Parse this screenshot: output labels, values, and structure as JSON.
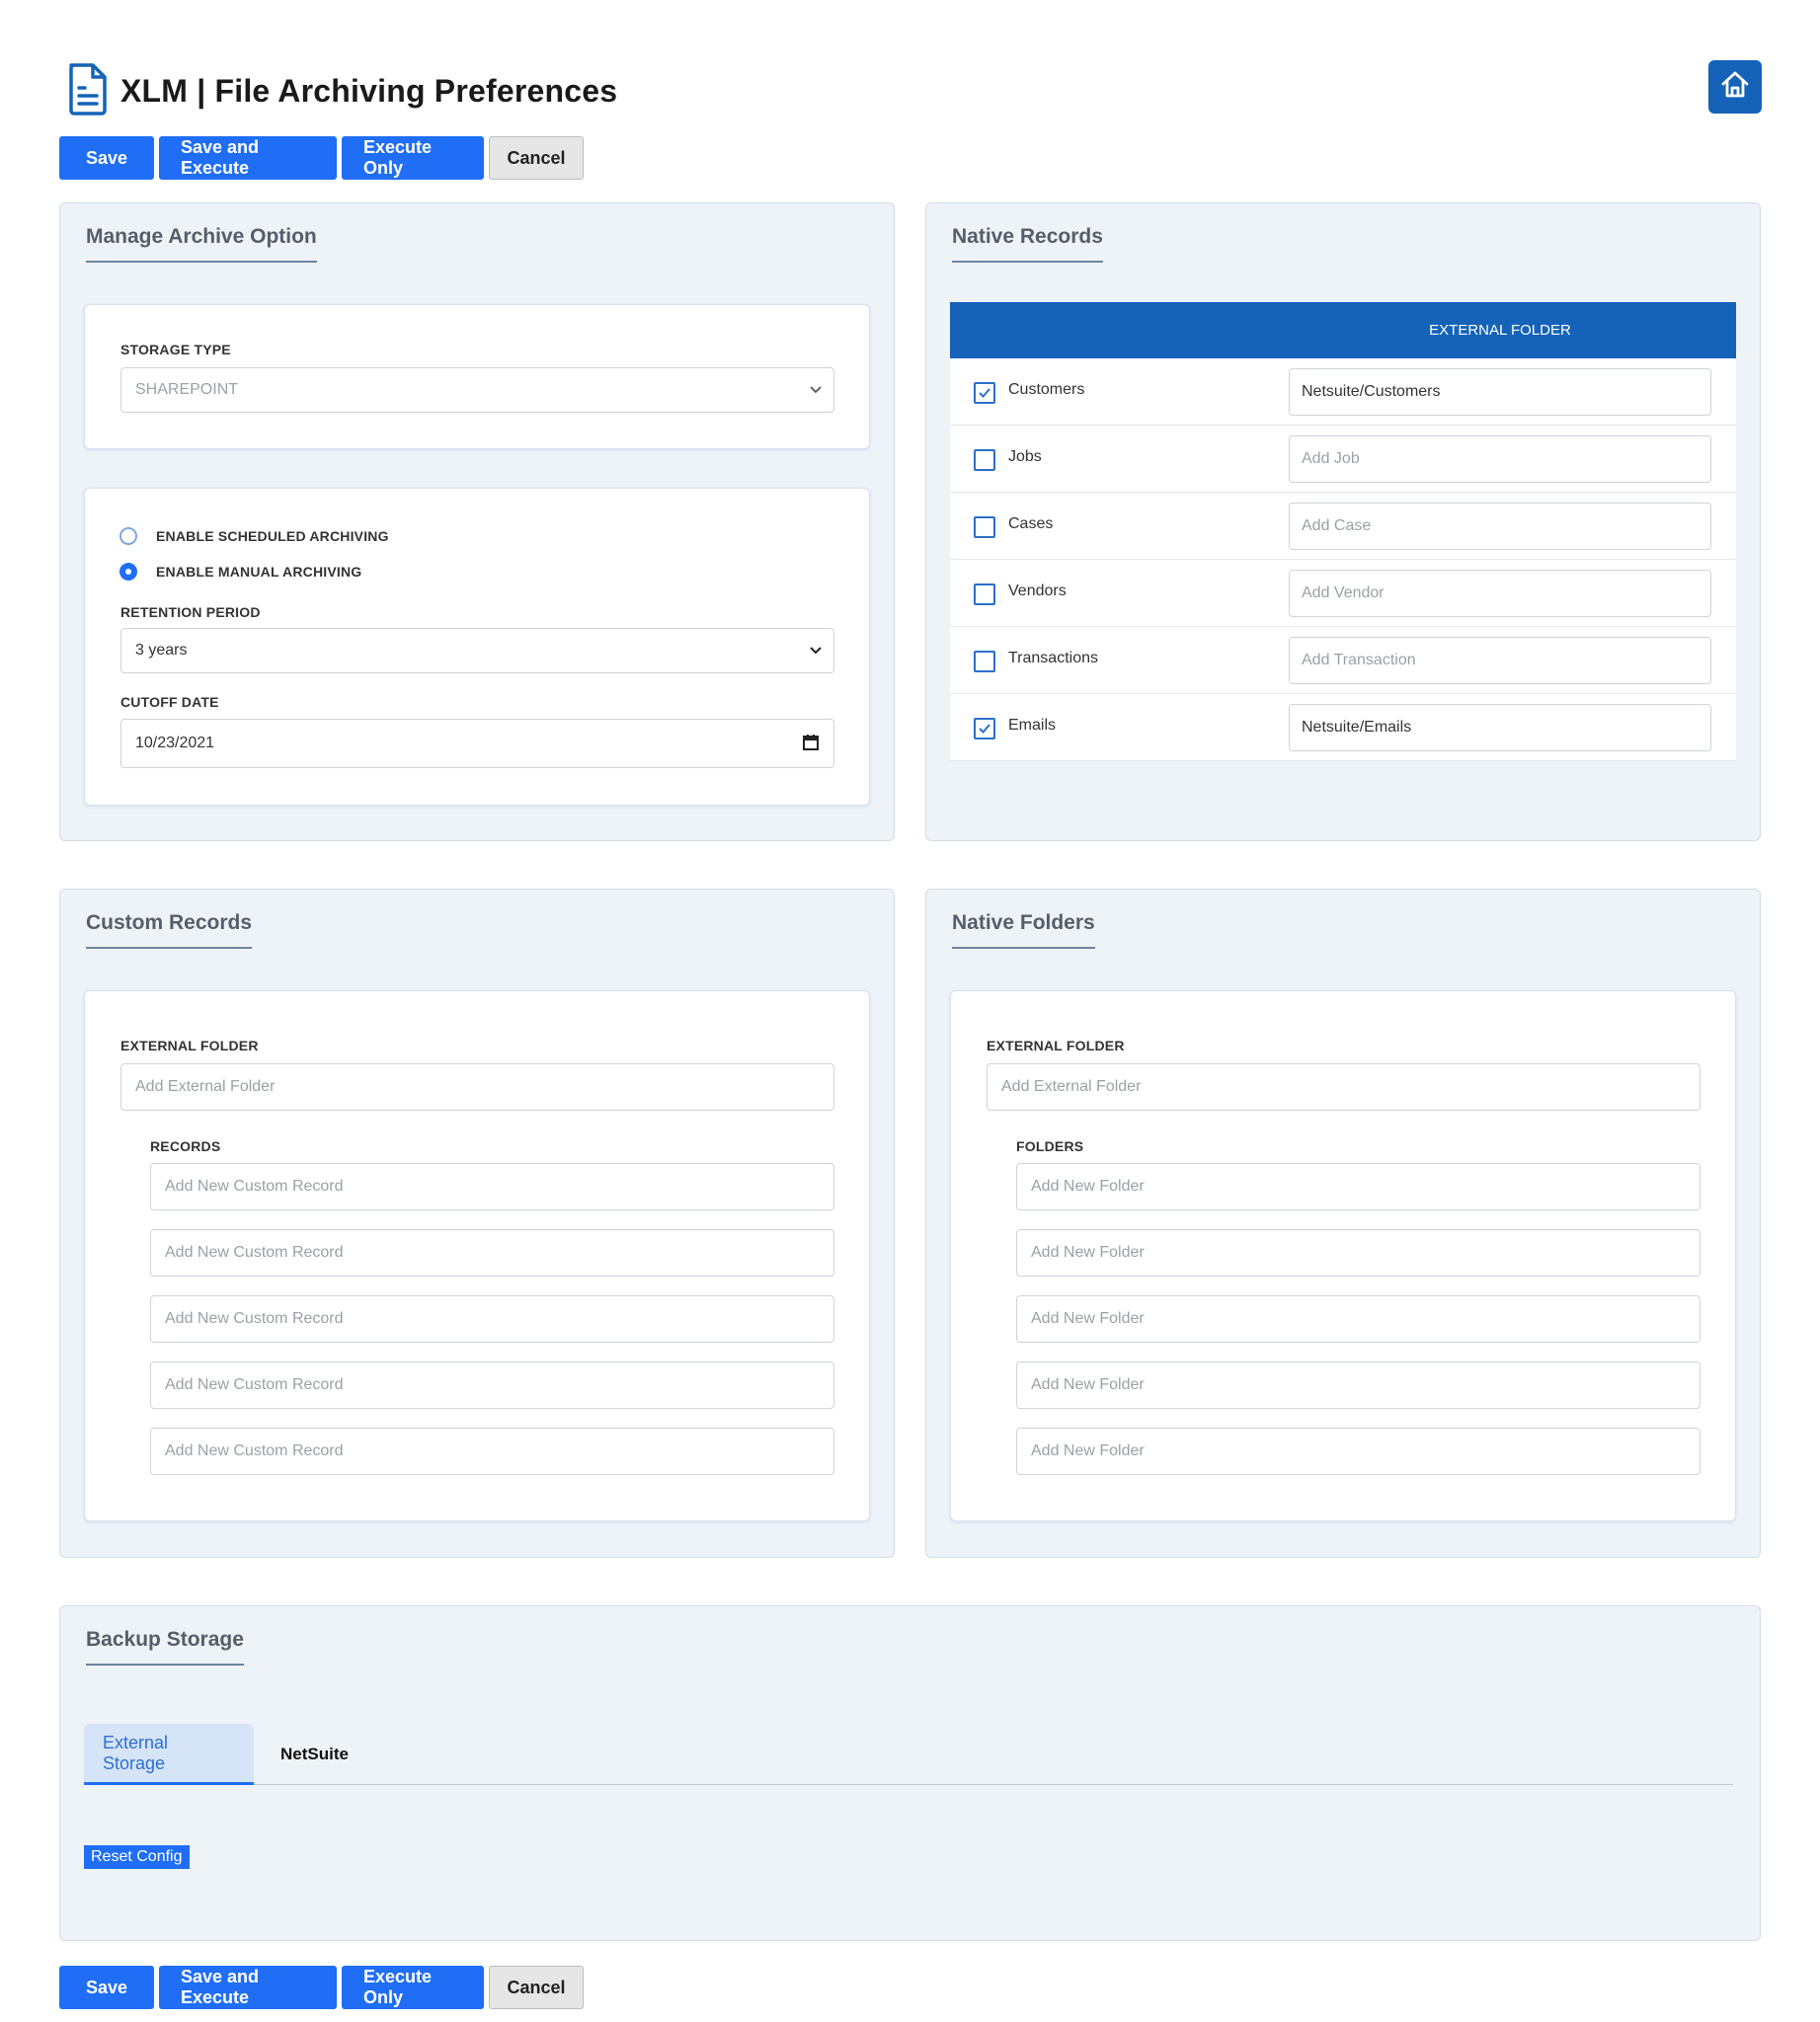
{
  "header": {
    "title": "XLM | File Archiving Preferences",
    "icon": "document-icon",
    "home_icon": "home-icon"
  },
  "actions": {
    "save": "Save",
    "save_execute": "Save and Execute",
    "execute_only": "Execute Only",
    "cancel": "Cancel"
  },
  "manage_archive": {
    "title": "Manage Archive Option",
    "storage_type_label": "STORAGE TYPE",
    "storage_type_value": "SHAREPOINT",
    "radio_scheduled": "ENABLE SCHEDULED ARCHIVING",
    "radio_manual": "ENABLE MANUAL ARCHIVING",
    "selected_mode": "manual",
    "retention_label": "RETENTION PERIOD",
    "retention_value": "3 years",
    "cutoff_label": "CUTOFF DATE",
    "cutoff_value": "10/23/2021"
  },
  "native_records": {
    "title": "Native Records",
    "column_header": "EXTERNAL FOLDER",
    "rows": [
      {
        "label": "Customers",
        "checked": true,
        "value": "Netsuite/Customers",
        "placeholder": ""
      },
      {
        "label": "Jobs",
        "checked": false,
        "value": "",
        "placeholder": "Add Job"
      },
      {
        "label": "Cases",
        "checked": false,
        "value": "",
        "placeholder": "Add Case"
      },
      {
        "label": "Vendors",
        "checked": false,
        "value": "",
        "placeholder": "Add Vendor"
      },
      {
        "label": "Transactions",
        "checked": false,
        "value": "",
        "placeholder": "Add Transaction"
      },
      {
        "label": "Emails",
        "checked": true,
        "value": "Netsuite/Emails",
        "placeholder": ""
      }
    ]
  },
  "custom_records": {
    "title": "Custom Records",
    "external_folder_label": "EXTERNAL FOLDER",
    "external_folder_placeholder": "Add External Folder",
    "records_label": "RECORDS",
    "records": [
      "Add New Custom Record",
      "Add New Custom Record",
      "Add New Custom Record",
      "Add New Custom Record",
      "Add New Custom Record"
    ]
  },
  "native_folders": {
    "title": "Native Folders",
    "external_folder_label": "EXTERNAL FOLDER",
    "external_folder_placeholder": "Add External Folder",
    "folders_label": "FOLDERS",
    "folders": [
      "Add New Folder",
      "Add New Folder",
      "Add New Folder",
      "Add New Folder",
      "Add New Folder"
    ]
  },
  "backup_storage": {
    "title": "Backup Storage",
    "tabs": [
      "External Storage",
      "NetSuite"
    ],
    "active_tab": "External Storage",
    "reset_label": "Reset Config"
  },
  "colors": {
    "primary": "#1f6ef5",
    "header_blue": "#1463b8",
    "panel_bg": "#eef3f8"
  }
}
